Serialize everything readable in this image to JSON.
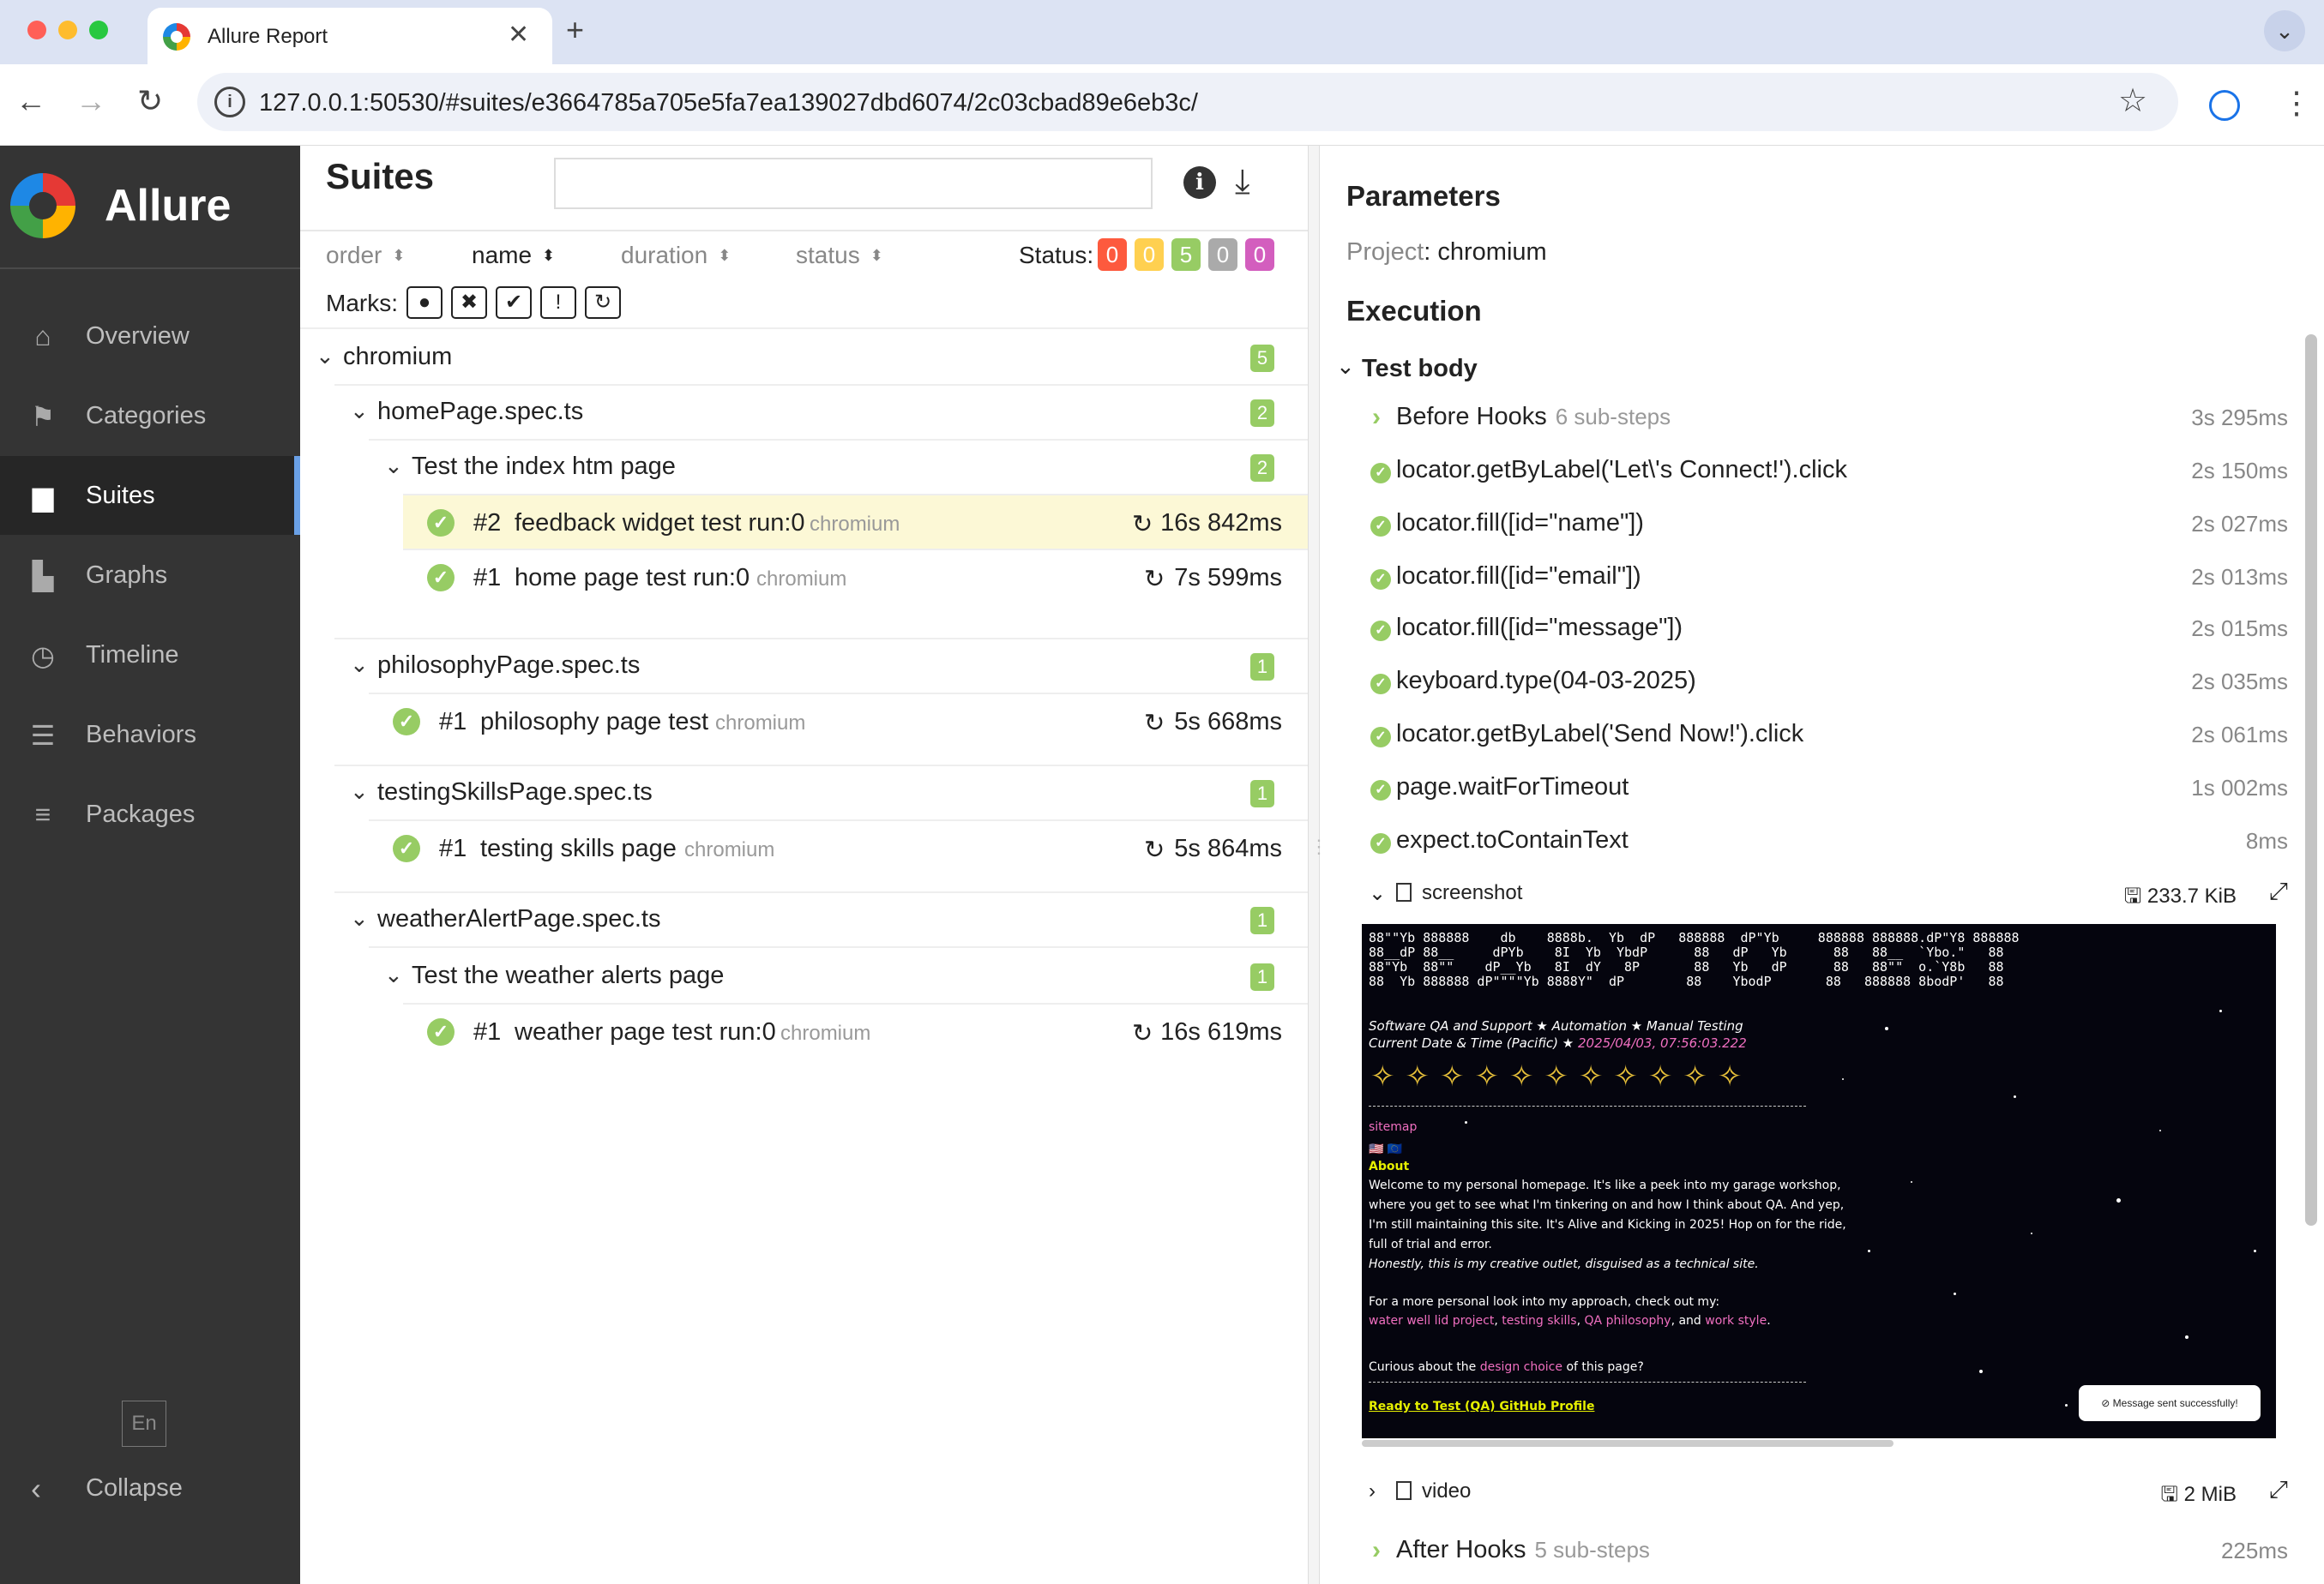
{
  "browser": {
    "tab_title": "Allure Report",
    "tab_close": "✕",
    "new_tab": "+",
    "url": "127.0.0.1:50530/#suites/e3664785a705e5fa7ea139027dbd6074/2c03cbad89e6eb3c/",
    "colors": {
      "tab_bar": "#dce3f3",
      "close": "#ff5f57",
      "minimize": "#febc2e",
      "maximize": "#28c840"
    }
  },
  "sidebar": {
    "brand": "Allure",
    "items": [
      {
        "label": "Overview",
        "icon": "home-icon"
      },
      {
        "label": "Categories",
        "icon": "flag-icon"
      },
      {
        "label": "Suites",
        "icon": "briefcase-icon",
        "active": true
      },
      {
        "label": "Graphs",
        "icon": "bar-chart-icon"
      },
      {
        "label": "Timeline",
        "icon": "clock-icon"
      },
      {
        "label": "Behaviors",
        "icon": "list-icon"
      },
      {
        "label": "Packages",
        "icon": "packages-icon"
      }
    ],
    "language": "En",
    "collapse": "Collapse"
  },
  "suites": {
    "title": "Suites",
    "search_placeholder": "",
    "sort": {
      "order": "order",
      "name": "name",
      "duration": "duration",
      "status": "status"
    },
    "status_label": "Status:",
    "status_counts": [
      {
        "value": "0",
        "color": "#fd5a3e"
      },
      {
        "value": "0",
        "color": "#ffd050"
      },
      {
        "value": "5",
        "color": "#97cc64"
      },
      {
        "value": "0",
        "color": "#aaaaaa"
      },
      {
        "value": "0",
        "color": "#d35ebe"
      }
    ],
    "marks_label": "Marks:",
    "tree": {
      "root": {
        "name": "chromium",
        "count": "5"
      },
      "home": {
        "name": "homePage.spec.ts",
        "count": "2"
      },
      "index": {
        "name": "Test the index htm page",
        "count": "2"
      },
      "t1": {
        "num": "#2",
        "name": "feedback widget test run:0",
        "tag": "chromium",
        "duration": "16s 842ms"
      },
      "t2": {
        "num": "#1",
        "name": "home page test run:0",
        "tag": "chromium",
        "duration": "7s 599ms"
      },
      "philo": {
        "name": "philosophyPage.spec.ts",
        "count": "1"
      },
      "t3": {
        "num": "#1",
        "name": "philosophy page test",
        "tag": "chromium",
        "duration": "5s 668ms"
      },
      "testing": {
        "name": "testingSkillsPage.spec.ts",
        "count": "1"
      },
      "t4": {
        "num": "#1",
        "name": "testing skills page",
        "tag": "chromium",
        "duration": "5s 864ms"
      },
      "weather": {
        "name": "weatherAlertPage.spec.ts",
        "count": "1"
      },
      "weather_suite": {
        "name": "Test the weather alerts page",
        "count": "1"
      },
      "t5": {
        "num": "#1",
        "name": "weather page test run:0",
        "tag": "chromium",
        "duration": "16s 619ms"
      }
    }
  },
  "details": {
    "parameters_title": "Parameters",
    "param_key": "Project",
    "param_value": ": chromium",
    "execution_title": "Execution",
    "test_body": "Test body",
    "steps": [
      {
        "name": "Before Hooks",
        "sub": "6 sub-steps",
        "duration": "3s 295ms",
        "kind": "group"
      },
      {
        "name": "locator.getByLabel('Let\\'s Connect!').click",
        "duration": "2s 150ms"
      },
      {
        "name": "locator.fill([id=\"name\"])",
        "duration": "2s 027ms"
      },
      {
        "name": "locator.fill([id=\"email\"])",
        "duration": "2s 013ms"
      },
      {
        "name": "locator.fill([id=\"message\"])",
        "duration": "2s 015ms"
      },
      {
        "name": "keyboard.type(04-03-2025)",
        "duration": "2s 035ms"
      },
      {
        "name": "locator.getByLabel('Send Now!').click",
        "duration": "2s 061ms"
      },
      {
        "name": "page.waitForTimeout",
        "duration": "1s 002ms"
      },
      {
        "name": "expect.toContainText",
        "duration": "8ms"
      }
    ],
    "screenshot": {
      "name": "screenshot",
      "size": "233.7 KiB"
    },
    "video": {
      "name": "video",
      "size": "2 MiB"
    },
    "after_hooks": {
      "name": "After Hooks",
      "sub": "5 sub-steps",
      "duration": "225ms"
    },
    "shot_content": {
      "ascii": "88\"\"Yb 888888    db    8888b.  Yb  dP   888888  dP\"Yb     888888 888888.dP\"Y8 888888\n88__dP 88__     dPYb    8I  Yb  YbdP      88   dP   Yb      88   88__  `Ybo.\"   88\n88\"Yb  88\"\"    dP__Yb   8I  dY   8P       88   Yb   dP      88   88\"\"  o.`Y8b   88\n88  Yb 888888 dP\"\"\"\"Yb 8888Y\"  dP        88    YbodP       88   888888 8bodP'   88",
      "tagline": "Software QA and Support ★ Automation ★ Manual Testing",
      "date_prefix": "Current Date & Time (Pacific) ★ ",
      "date_value": "2025/04/03, 07:56:03.222",
      "stars": "✧✧✧✧✧✧✧✧✧✧✧",
      "sitemap": "sitemap",
      "about": "About",
      "para1a": "Welcome to my personal homepage. It's like a peek into my garage workshop, where you get to see what I'm tinkering on and how I think about QA. And yep, I'm still maintaining this site. It's Alive and Kicking in 2025! Hop on for the ride, full of trial and error.",
      "para1b": "Honestly, this is my creative outlet, disguised as a technical site.",
      "para2": "For a more personal look into my approach, check out my:",
      "link1": "water well lid project",
      "link2": "testing skills",
      "link3": "QA philosophy",
      "link_and": ", and",
      "link4": "work style",
      "para3a": "Curious about the",
      "design_link": "design choice",
      "para3b": "of this page?",
      "github": "Ready to Test (QA) GitHub Profile",
      "toast": "Message sent successfully!"
    }
  }
}
